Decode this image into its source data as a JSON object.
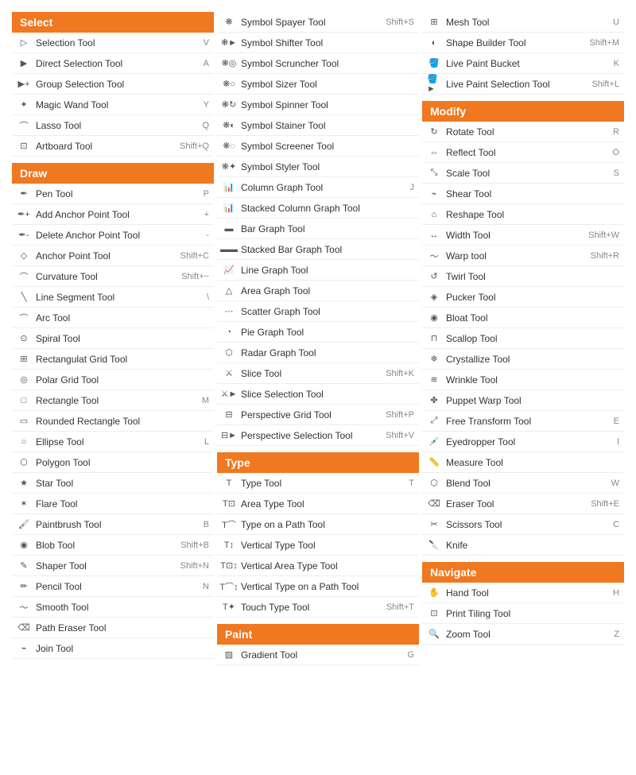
{
  "columns": [
    {
      "sections": [
        {
          "header": "Select",
          "tools": [
            {
              "name": "Selection Tool",
              "shortcut": "V",
              "icon": "▷"
            },
            {
              "name": "Direct Selection Tool",
              "shortcut": "A",
              "icon": "▶"
            },
            {
              "name": "Group Selection Tool",
              "shortcut": "",
              "icon": "▶+"
            },
            {
              "name": "Magic Wand Tool",
              "shortcut": "Y",
              "icon": "✦"
            },
            {
              "name": "Lasso Tool",
              "shortcut": "Q",
              "icon": "⌒"
            },
            {
              "name": "Artboard Tool",
              "shortcut": "Shift+Q",
              "icon": "⊡"
            }
          ]
        },
        {
          "header": "Draw",
          "tools": [
            {
              "name": "Pen Tool",
              "shortcut": "P",
              "icon": "✒"
            },
            {
              "name": "Add Anchor Point Tool",
              "shortcut": "+",
              "icon": "✒+"
            },
            {
              "name": "Delete Anchor Point Tool",
              "shortcut": "-",
              "icon": "✒-"
            },
            {
              "name": "Anchor Point Tool",
              "shortcut": "Shift+C",
              "icon": "◇"
            },
            {
              "name": "Curvature Tool",
              "shortcut": "Shift+~",
              "icon": "⌒"
            },
            {
              "name": "Line Segment Tool",
              "shortcut": "\\",
              "icon": "╲"
            },
            {
              "name": "Arc Tool",
              "shortcut": "",
              "icon": "⌒"
            },
            {
              "name": "Spiral Tool",
              "shortcut": "",
              "icon": "⊙"
            },
            {
              "name": "Rectangulat Grid Tool",
              "shortcut": "",
              "icon": "⊞"
            },
            {
              "name": "Polar Grid Tool",
              "shortcut": "",
              "icon": "◎"
            },
            {
              "name": "Rectangle Tool",
              "shortcut": "M",
              "icon": "□"
            },
            {
              "name": "Rounded Rectangle Tool",
              "shortcut": "",
              "icon": "▭"
            },
            {
              "name": "Ellipse Tool",
              "shortcut": "L",
              "icon": "○"
            },
            {
              "name": "Polygon Tool",
              "shortcut": "",
              "icon": "⬡"
            },
            {
              "name": "Star Tool",
              "shortcut": "",
              "icon": "★"
            },
            {
              "name": "Flare Tool",
              "shortcut": "",
              "icon": "✶"
            },
            {
              "name": "Paintbrush Tool",
              "shortcut": "B",
              "icon": "🖌"
            },
            {
              "name": "Blob Tool",
              "shortcut": "Shift+B",
              "icon": "◉"
            },
            {
              "name": "Shaper Tool",
              "shortcut": "Shift+N",
              "icon": "✎"
            },
            {
              "name": "Pencil Tool",
              "shortcut": "N",
              "icon": "✏"
            },
            {
              "name": "Smooth Tool",
              "shortcut": "",
              "icon": "〜"
            },
            {
              "name": "Path Eraser Tool",
              "shortcut": "",
              "icon": "⌫"
            },
            {
              "name": "Join Tool",
              "shortcut": "",
              "icon": "⌁"
            }
          ]
        }
      ]
    },
    {
      "sections": [
        {
          "header": null,
          "tools": [
            {
              "name": "Symbol Spayer Tool",
              "shortcut": "Shift+S",
              "icon": "❋"
            },
            {
              "name": "Symbol Shifter Tool",
              "shortcut": "",
              "icon": "❋►"
            },
            {
              "name": "Symbol Scruncher Tool",
              "shortcut": "",
              "icon": "❋◎"
            },
            {
              "name": "Symbol Sizer Tool",
              "shortcut": "",
              "icon": "❋○"
            },
            {
              "name": "Symbol Spinner Tool",
              "shortcut": "",
              "icon": "❋↻"
            },
            {
              "name": "Symbol Stainer Tool",
              "shortcut": "",
              "icon": "❋◐"
            },
            {
              "name": "Symbol Screener Tool",
              "shortcut": "",
              "icon": "❋◌"
            },
            {
              "name": "Symbol Styler Tool",
              "shortcut": "",
              "icon": "❋✦"
            },
            {
              "name": "Column Graph Tool",
              "shortcut": "J",
              "icon": "📊"
            },
            {
              "name": "Stacked Column Graph Tool",
              "shortcut": "",
              "icon": "📊"
            },
            {
              "name": "Bar Graph Tool",
              "shortcut": "",
              "icon": "▬"
            },
            {
              "name": "Stacked Bar Graph Tool",
              "shortcut": "",
              "icon": "▬▬"
            },
            {
              "name": "Line Graph Tool",
              "shortcut": "",
              "icon": "📈"
            },
            {
              "name": "Area Graph Tool",
              "shortcut": "",
              "icon": "△"
            },
            {
              "name": "Scatter Graph Tool",
              "shortcut": "",
              "icon": "⋯"
            },
            {
              "name": "Pie Graph Tool",
              "shortcut": "",
              "icon": "◔"
            },
            {
              "name": "Radar Graph Tool",
              "shortcut": "",
              "icon": "⬡"
            },
            {
              "name": "Slice Tool",
              "shortcut": "Shift+K",
              "icon": "⚔"
            },
            {
              "name": "Slice Selection Tool",
              "shortcut": "",
              "icon": "⚔►"
            },
            {
              "name": "Perspective Grid Tool",
              "shortcut": "Shift+P",
              "icon": "⊟"
            },
            {
              "name": "Perspective Selection Tool",
              "shortcut": "Shift+V",
              "icon": "⊟►"
            }
          ]
        },
        {
          "header": "Type",
          "tools": [
            {
              "name": "Type Tool",
              "shortcut": "T",
              "icon": "T"
            },
            {
              "name": "Area Type Tool",
              "shortcut": "",
              "icon": "T⊡"
            },
            {
              "name": "Type on a Path Tool",
              "shortcut": "",
              "icon": "T⌒"
            },
            {
              "name": "Vertical Type Tool",
              "shortcut": "",
              "icon": "T↕"
            },
            {
              "name": "Vertical Area Type Tool",
              "shortcut": "",
              "icon": "T⊡↕"
            },
            {
              "name": "Vertical Type on a Path Tool",
              "shortcut": "",
              "icon": "T⌒↕"
            },
            {
              "name": "Touch Type Tool",
              "shortcut": "Shift+T",
              "icon": "T✦"
            }
          ]
        },
        {
          "header": "Paint",
          "tools": [
            {
              "name": "Gradient Tool",
              "shortcut": "G",
              "icon": "▨"
            }
          ]
        }
      ]
    },
    {
      "sections": [
        {
          "header": null,
          "tools": [
            {
              "name": "Mesh Tool",
              "shortcut": "U",
              "icon": "⊞"
            },
            {
              "name": "Shape Builder Tool",
              "shortcut": "Shift+M",
              "icon": "◐"
            },
            {
              "name": "Live Paint Bucket",
              "shortcut": "K",
              "icon": "🪣"
            },
            {
              "name": "Live Paint Selection Tool",
              "shortcut": "Shift+L",
              "icon": "🪣►"
            }
          ]
        },
        {
          "header": "Modify",
          "tools": [
            {
              "name": "Rotate Tool",
              "shortcut": "R",
              "icon": "↻"
            },
            {
              "name": "Reflect Tool",
              "shortcut": "O",
              "icon": "⇔"
            },
            {
              "name": "Scale Tool",
              "shortcut": "S",
              "icon": "⤡"
            },
            {
              "name": "Shear Tool",
              "shortcut": "",
              "icon": "⌁"
            },
            {
              "name": "Reshape Tool",
              "shortcut": "",
              "icon": "⌂"
            },
            {
              "name": "Width Tool",
              "shortcut": "Shift+W",
              "icon": "↔"
            },
            {
              "name": "Warp tool",
              "shortcut": "Shift+R",
              "icon": "〜"
            },
            {
              "name": "Twirl Tool",
              "shortcut": "",
              "icon": "↺"
            },
            {
              "name": "Pucker Tool",
              "shortcut": "",
              "icon": "◈"
            },
            {
              "name": "Bloat Tool",
              "shortcut": "",
              "icon": "◉"
            },
            {
              "name": "Scallop Tool",
              "shortcut": "",
              "icon": "⊓"
            },
            {
              "name": "Crystallize Tool",
              "shortcut": "",
              "icon": "❄"
            },
            {
              "name": "Wrinkle Tool",
              "shortcut": "",
              "icon": "≋"
            },
            {
              "name": "Puppet Warp Tool",
              "shortcut": "",
              "icon": "✤"
            },
            {
              "name": "Free Transform Tool",
              "shortcut": "E",
              "icon": "⤢"
            },
            {
              "name": "Eyedropper Tool",
              "shortcut": "I",
              "icon": "💉"
            },
            {
              "name": "Measure Tool",
              "shortcut": "",
              "icon": "📏"
            },
            {
              "name": "Blend Tool",
              "shortcut": "W",
              "icon": "⬡"
            },
            {
              "name": "Eraser Tool",
              "shortcut": "Shift+E",
              "icon": "⌫"
            },
            {
              "name": "Scissors Tool",
              "shortcut": "C",
              "icon": "✂"
            },
            {
              "name": "Knife",
              "shortcut": "",
              "icon": "🔪"
            }
          ]
        },
        {
          "header": "Navigate",
          "tools": [
            {
              "name": "Hand Tool",
              "shortcut": "H",
              "icon": "✋"
            },
            {
              "name": "Print Tiling Tool",
              "shortcut": "",
              "icon": "⊡"
            },
            {
              "name": "Zoom Tool",
              "shortcut": "Z",
              "icon": "🔍"
            }
          ]
        }
      ]
    }
  ]
}
